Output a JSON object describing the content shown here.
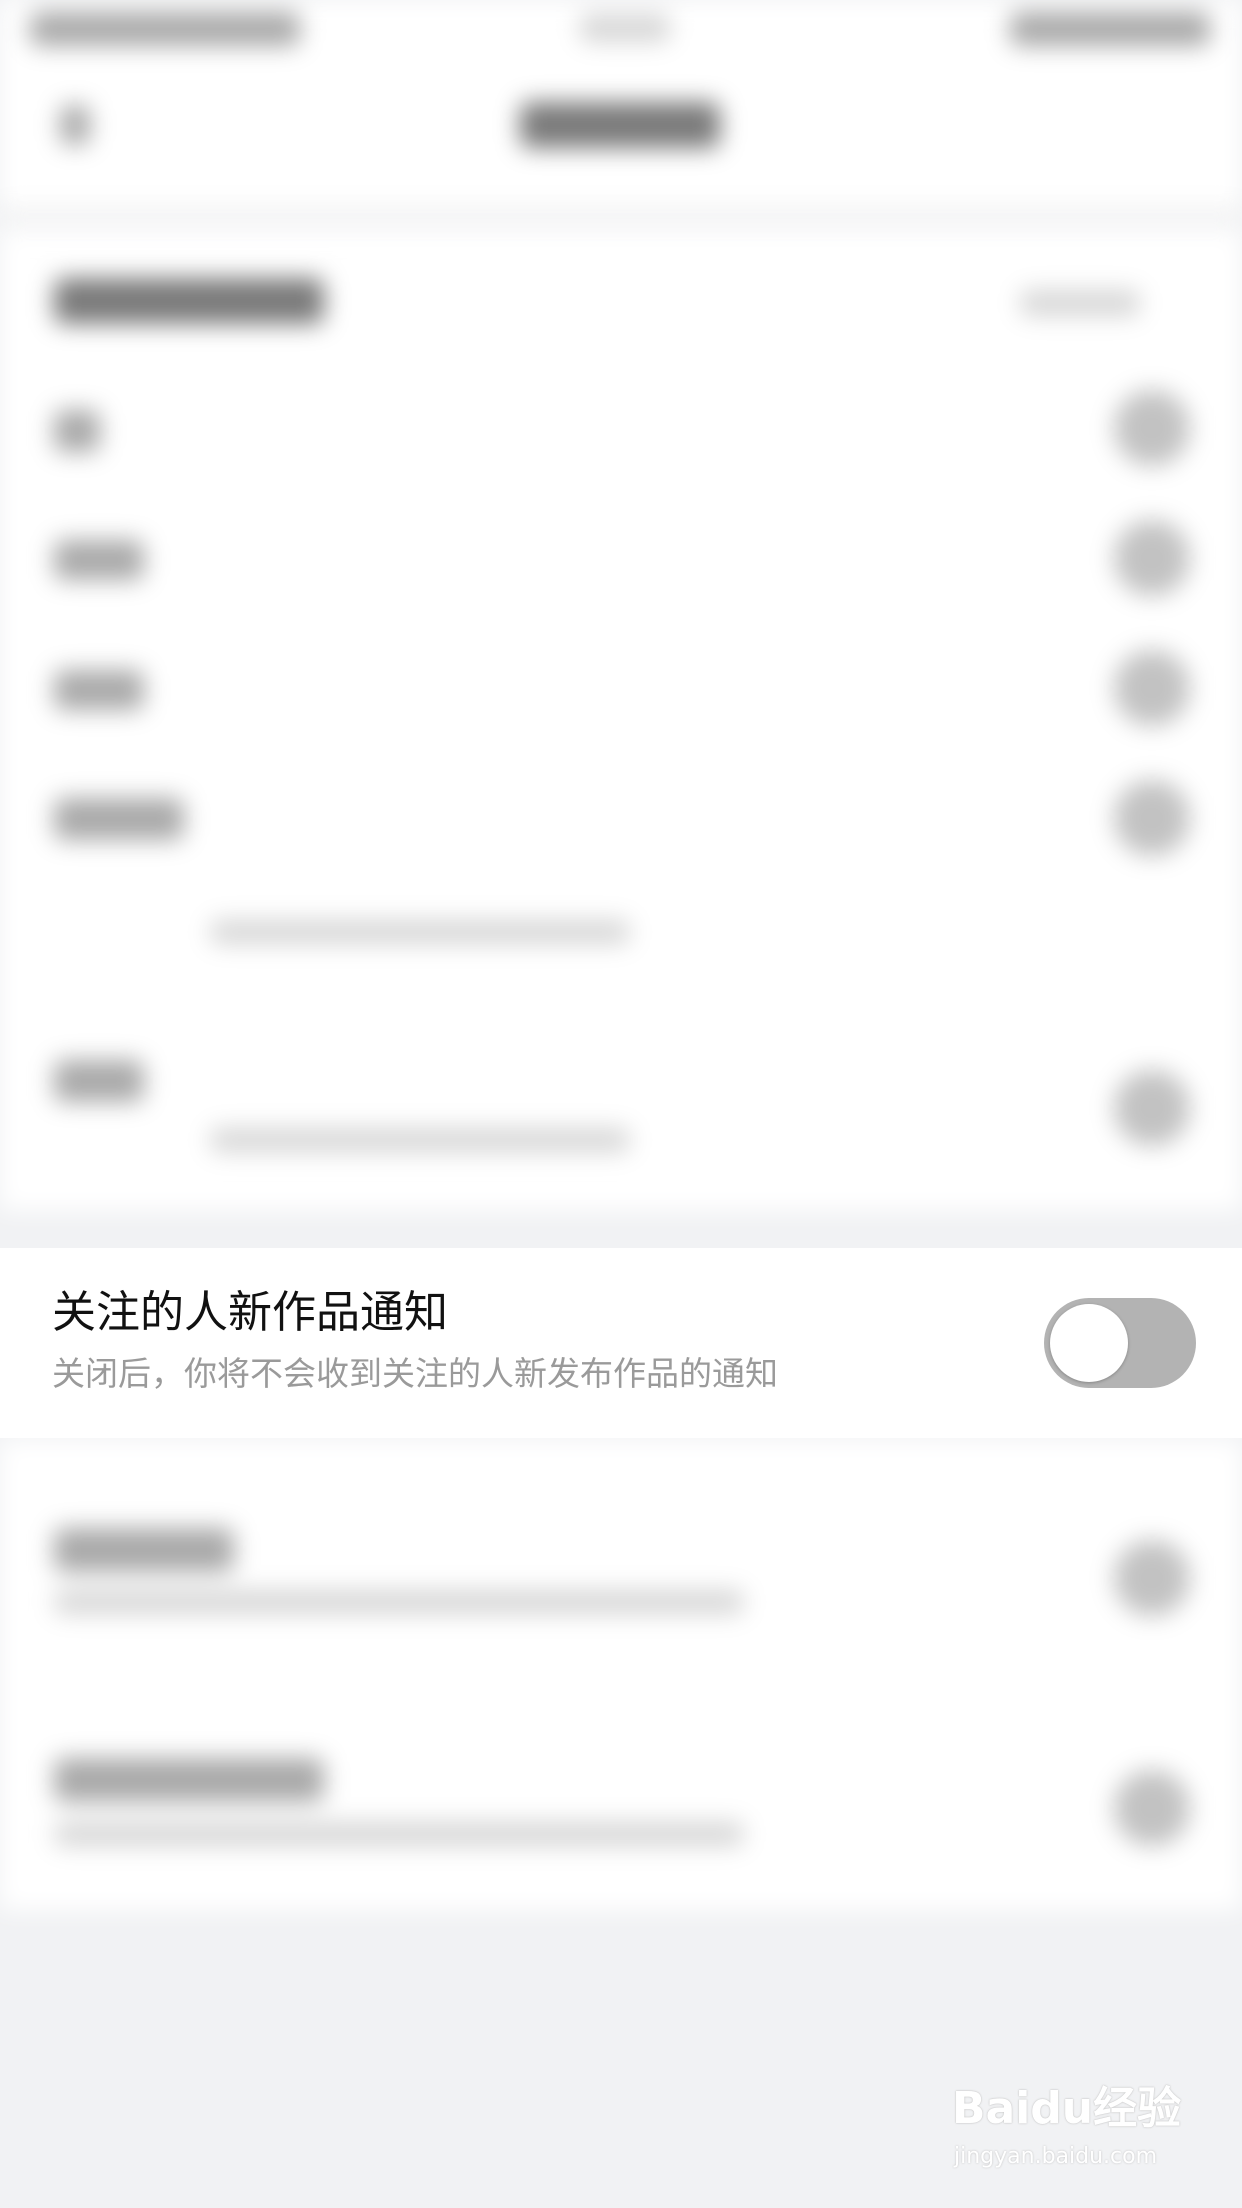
{
  "setting_row": {
    "title": "关注的人新作品通知",
    "description": "关闭后，你将不会收到关注的人新发布作品的通知",
    "toggle_state": "off"
  },
  "colors": {
    "toggle_off_track": "#b3b3b3",
    "toggle_knob": "#ffffff",
    "title_text": "#111111",
    "description_text": "#9a9a9a",
    "page_background": "#f1f2f4"
  },
  "watermark": {
    "logo_text": "Baidu经验",
    "url_text": "jingyan.baidu.com"
  }
}
